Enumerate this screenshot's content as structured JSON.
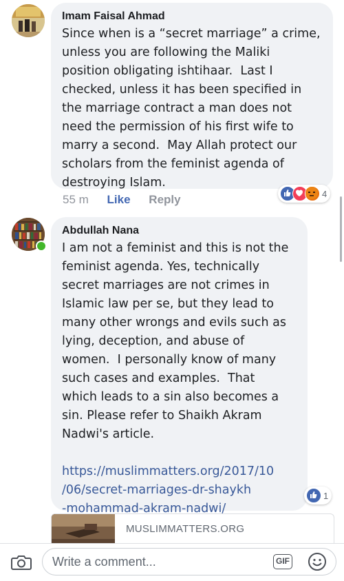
{
  "comments": [
    {
      "author": "Imam Faisal Ahmad",
      "text": "Since when is a “secret marriage” a crime,\nunless you are following the Maliki\nposition obligating ishtihaar.  Last I\nchecked, unless it has been specified in\nthe marriage contract a man does not\nneed the permission of his first wife to\nmarry a second.  May Allah protect our\nscholars from the feminist agenda of\ndestroying Islam.",
      "time": "55 m",
      "like_label": "Like",
      "reply_label": "Reply",
      "reaction_count": "4",
      "reactions": [
        "like-icon",
        "love-icon",
        "angry-icon"
      ]
    },
    {
      "author": "Abdullah Nana",
      "text": "I am not a feminist and this is not the\nfeminist agenda. Yes, technically\nsecret marriages are not crimes in\nIslamic law per se, but they lead to\nmany other wrongs and evils such as\nlying, deception, and abuse of\nwomen.  I personally know of many\nsuch cases and examples.  That\nwhich leads to a sin also becomes a\nsin. Please refer to Shaikh Akram\nNadwi's article.",
      "link": "https://muslimmatters.org/2017/10\n/06/secret-marriages-dr-shaykh\n-mohammad-akram-nadwi/",
      "reaction_count": "1",
      "reactions": [
        "like-icon"
      ],
      "online": true
    }
  ],
  "link_preview": {
    "domain": "MUSLIMMATTERS.ORG"
  },
  "composer": {
    "placeholder": "Write a comment...",
    "gif_label": "GIF"
  },
  "colors": {
    "like_blue": "#4267b2",
    "love_red": "#f33e58",
    "angry_orange": "#e9710f",
    "link": "#385898",
    "online_green": "#42b72a",
    "bubble_bg": "#f0f2f5"
  }
}
